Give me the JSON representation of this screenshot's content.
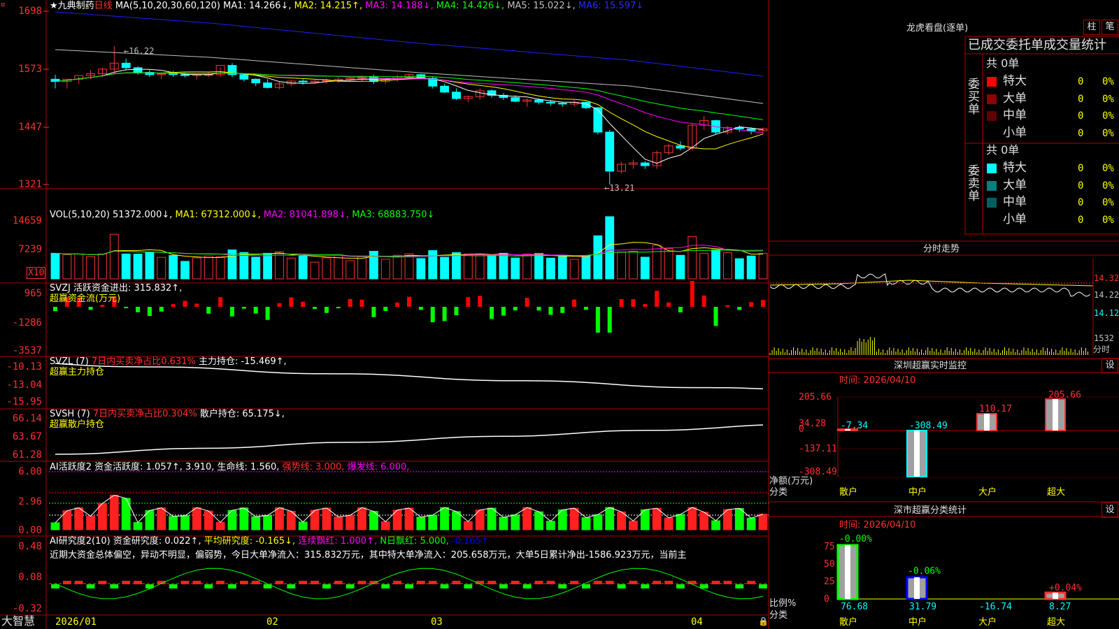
{
  "header": {
    "stock_name": "★九典制药",
    "period": "日线",
    "ma_label": "MA(5,10,20,30,60,120)",
    "ma1": "MA1: 14.266↓,",
    "ma2": "MA2: 14.215↑,",
    "ma3": "MA3: 14.188↓,",
    "ma4": "MA4: 14.426↓,",
    "ma5": "MA5: 15.022↓,",
    "ma6": "MA6: 15.597↓"
  },
  "price_axis": [
    "1698",
    "1573",
    "1447",
    "1321"
  ],
  "price_marks": {
    "high": "16.22",
    "low": "13.21"
  },
  "vol": {
    "title": "VOL(5,10,20)",
    "value": "51372.000↓,",
    "ma1": "MA1: 67312.000↓,",
    "ma2": "MA2: 81041.898↓,",
    "ma3": "MA3: 68883.750↓",
    "axis": [
      "14659",
      "7239"
    ],
    "unit": "X10"
  },
  "svzj": {
    "title": "SVZJ",
    "label": "活跃资金进出: 315.832↑,",
    "sub": "超赢资金流(万元)",
    "axis": [
      "965",
      "-1286",
      "-3537"
    ]
  },
  "svzl": {
    "title": "SVZL (7)",
    "ratio": "7日内买卖净占比0.631%",
    "label": "主力持仓: -15.469↑,",
    "sub": "超赢主力持仓",
    "axis": [
      "-10.13",
      "-13.04",
      "-15.95"
    ]
  },
  "svsh": {
    "title": "SVSH (7)",
    "ratio": "7日内买卖净占比0.304%",
    "label": "散户持仓: 65.175↓,",
    "sub": "超赢散户持仓",
    "axis": [
      "66.14",
      "63.67",
      "61.28"
    ]
  },
  "ai_active": {
    "title": "AI活跃度2",
    "label": "资金活跃度: 1.057↑,",
    "v2": "3.910,",
    "life": "生命线: 1.560,",
    "strong": "强势线: 3.000,",
    "burst": "爆发线: 6.000,",
    "axis": [
      "6.00",
      "2.96",
      "0.00"
    ]
  },
  "ai_research": {
    "title": "AI研究度2(10)",
    "label": "资金研究度: 0.022↑,",
    "avg": "平均研究度: -0.165↓,",
    "red": "连续飘红: 1.000↑,",
    "nred": "N日飘红: 5.000,",
    "last": "-0.165↑",
    "axis": [
      "0.48",
      "0.08",
      "-0.32"
    ],
    "comment": "近期大资金总体偏空，异动不明显，偏弱势，今日大单净流入：315.832万元，其中特大单净流入：205.658万元，大单5日累计净出-1586.923万元，当前主"
  },
  "date_axis": [
    "2026/01",
    "02",
    "03",
    "04"
  ],
  "brand": "大智慧",
  "right": {
    "longhu_title": "龙虎看盘(逐单)",
    "tab_zhu": "柱",
    "tab_bi": "笔",
    "order_header": "已成交委托单成交量统计",
    "buy": {
      "label": [
        "委",
        "买",
        "单"
      ],
      "total": "共 0单",
      "rows": [
        {
          "name": "特大",
          "count": "0",
          "pct": "0%",
          "color": "#ff0000"
        },
        {
          "name": "大单",
          "count": "0",
          "pct": "0%",
          "color": "#900000"
        },
        {
          "name": "中单",
          "count": "0",
          "pct": "0%",
          "color": "#600000"
        },
        {
          "name": "小单",
          "count": "0",
          "pct": "0%",
          "color": "#000000"
        }
      ]
    },
    "sell": {
      "label": [
        "委",
        "卖",
        "单"
      ],
      "total": "共 0单",
      "rows": [
        {
          "name": "特大",
          "count": "0",
          "pct": "0%",
          "color": "#00ffff"
        },
        {
          "name": "大单",
          "count": "0",
          "pct": "0%",
          "color": "#008080"
        },
        {
          "name": "中单",
          "count": "0",
          "pct": "0%",
          "color": "#006060"
        },
        {
          "name": "小单",
          "count": "0",
          "pct": "0%",
          "color": "#000000"
        }
      ]
    },
    "intraday": {
      "title": "分时走势",
      "axis": [
        "14.32",
        "14.22",
        "14.12"
      ],
      "vol": "1532",
      "vol_label": "分时"
    },
    "monitor": {
      "title": "深圳超赢实时监控",
      "setting": "设",
      "time": "时间: 2026/04/10",
      "axis": [
        "205.66",
        "34.28",
        "0",
        "-137.11",
        "-308.49"
      ],
      "ylabel": "净额(万元)",
      "xlabel": "分类",
      "categories": [
        "散户",
        "中户",
        "大户",
        "超大"
      ],
      "values": [
        "-7.34",
        "-308.49",
        "110.17",
        "205.66"
      ]
    },
    "classify": {
      "title": "深市超赢分类统计",
      "setting": "设",
      "time": "时间: 2026/04/10",
      "axis": [
        "75",
        "50",
        "25",
        "0"
      ],
      "ylabel": "比例%",
      "xlabel": "分类",
      "categories": [
        "散户",
        "中户",
        "大户",
        "超大"
      ],
      "changes": [
        "-0.00%",
        "-0.06%",
        "+0.04%"
      ],
      "values": [
        "76.68",
        "31.79",
        "-16.74",
        "8.27"
      ]
    }
  },
  "colors": {
    "up": "#ff3232",
    "down": "#00ffff",
    "border": "#b00000",
    "ma1": "#ffffff",
    "ma2": "#ffff00",
    "ma3": "#ff00ff",
    "ma4": "#00ff00",
    "ma5": "#c0c0c0",
    "ma6": "#2020ff"
  },
  "chart_data": {
    "type": "candlestick",
    "title": "",
    "x": [
      "2026/01",
      "02",
      "03",
      "04"
    ],
    "ohlc": [
      [
        15.5,
        15.6,
        15.3,
        15.45
      ],
      [
        15.45,
        15.5,
        15.3,
        15.5
      ],
      [
        15.5,
        15.55,
        15.4,
        15.58
      ],
      [
        15.58,
        15.7,
        15.5,
        15.62
      ],
      [
        15.62,
        15.75,
        15.55,
        15.72
      ],
      [
        15.72,
        16.22,
        15.6,
        15.85
      ],
      [
        15.85,
        15.95,
        15.7,
        15.75
      ],
      [
        15.75,
        15.78,
        15.6,
        15.65
      ],
      [
        15.65,
        15.7,
        15.55,
        15.6
      ],
      [
        15.6,
        15.65,
        15.5,
        15.62
      ],
      [
        15.62,
        15.68,
        15.55,
        15.6
      ],
      [
        15.6,
        15.64,
        15.54,
        15.58
      ],
      [
        15.58,
        15.62,
        15.5,
        15.6
      ],
      [
        15.6,
        15.65,
        15.55,
        15.6
      ],
      [
        15.6,
        15.75,
        15.55,
        15.8
      ],
      [
        15.8,
        15.85,
        15.55,
        15.6
      ],
      [
        15.6,
        15.62,
        15.45,
        15.5
      ],
      [
        15.5,
        15.52,
        15.35,
        15.42
      ],
      [
        15.42,
        15.5,
        15.3,
        15.32
      ],
      [
        15.32,
        15.45,
        15.28,
        15.4
      ],
      [
        15.4,
        15.48,
        15.35,
        15.46
      ],
      [
        15.46,
        15.5,
        15.38,
        15.44
      ],
      [
        15.44,
        15.48,
        15.4,
        15.46
      ],
      [
        15.46,
        15.52,
        15.4,
        15.48
      ],
      [
        15.48,
        15.55,
        15.42,
        15.5
      ],
      [
        15.5,
        15.55,
        15.45,
        15.52
      ],
      [
        15.52,
        15.58,
        15.45,
        15.55
      ],
      [
        15.55,
        15.6,
        15.4,
        15.45
      ],
      [
        15.45,
        15.52,
        15.4,
        15.5
      ],
      [
        15.5,
        15.6,
        15.45,
        15.55
      ],
      [
        15.55,
        15.62,
        15.5,
        15.6
      ],
      [
        15.6,
        15.62,
        15.5,
        15.52
      ],
      [
        15.52,
        15.55,
        15.3,
        15.35
      ],
      [
        15.35,
        15.4,
        15.2,
        15.22
      ],
      [
        15.22,
        15.3,
        15.05,
        15.08
      ],
      [
        15.08,
        15.15,
        15.0,
        15.12
      ],
      [
        15.12,
        15.3,
        15.05,
        15.25
      ],
      [
        15.25,
        15.28,
        15.1,
        15.15
      ],
      [
        15.15,
        15.2,
        15.05,
        15.1
      ],
      [
        15.1,
        15.15,
        15.0,
        15.02
      ],
      [
        15.02,
        15.08,
        14.9,
        15.05
      ],
      [
        15.05,
        15.08,
        14.95,
        15.0
      ],
      [
        15.0,
        15.05,
        14.92,
        14.98
      ],
      [
        14.98,
        15.0,
        14.9,
        14.96
      ],
      [
        14.96,
        15.05,
        14.9,
        15.0
      ],
      [
        15.0,
        15.02,
        14.85,
        14.88
      ],
      [
        14.88,
        14.9,
        14.3,
        14.35
      ],
      [
        14.35,
        14.4,
        13.21,
        13.5
      ],
      [
        13.5,
        13.7,
        13.45,
        13.65
      ],
      [
        13.65,
        13.75,
        13.55,
        13.68
      ],
      [
        13.68,
        13.72,
        13.55,
        13.62
      ],
      [
        13.62,
        13.95,
        13.55,
        13.9
      ],
      [
        13.9,
        14.1,
        13.85,
        14.05
      ],
      [
        14.05,
        14.15,
        13.95,
        14.0
      ],
      [
        14.0,
        14.55,
        13.95,
        14.5
      ],
      [
        14.5,
        14.7,
        14.4,
        14.6
      ],
      [
        14.6,
        14.62,
        14.3,
        14.35
      ],
      [
        14.35,
        14.48,
        14.3,
        14.45
      ],
      [
        14.45,
        14.5,
        14.35,
        14.42
      ],
      [
        14.42,
        14.45,
        14.3,
        14.38
      ],
      [
        14.38,
        14.45,
        14.3,
        14.42
      ]
    ]
  }
}
